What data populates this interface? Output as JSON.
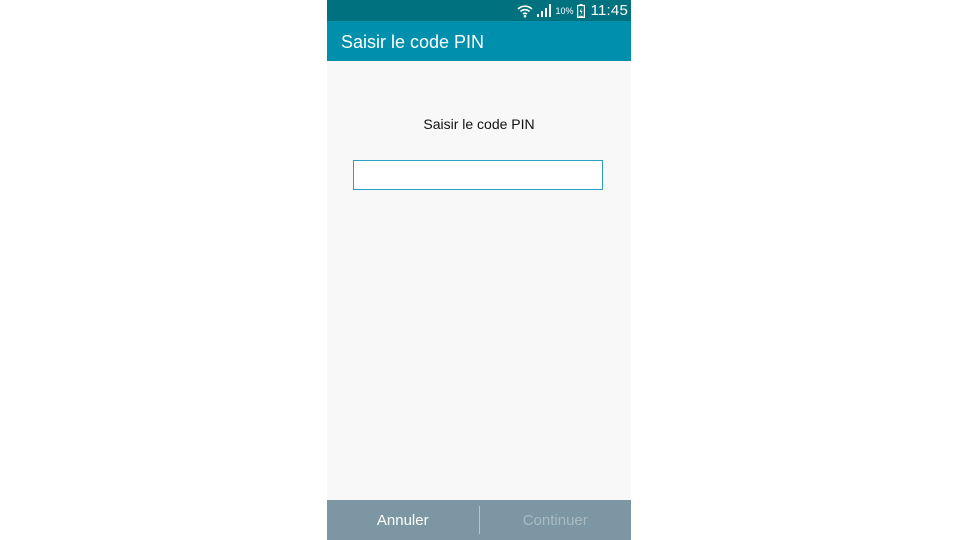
{
  "status_bar": {
    "battery_percent": "10%",
    "time": "11:45",
    "icons": [
      "wifi-icon",
      "signal-icon",
      "battery-icon"
    ]
  },
  "action_bar": {
    "title": "Saisir le code PIN"
  },
  "content": {
    "prompt": "Saisir le code PIN",
    "pin_value": ""
  },
  "bottom_bar": {
    "cancel_label": "Annuler",
    "continue_label": "Continuer",
    "continue_enabled": false
  },
  "colors": {
    "status_bar": "#00727f",
    "action_bar": "#0090ad",
    "bottom_bar": "#7c97a3",
    "input_border": "#2a9fc2",
    "background": "#f8f8f8"
  }
}
